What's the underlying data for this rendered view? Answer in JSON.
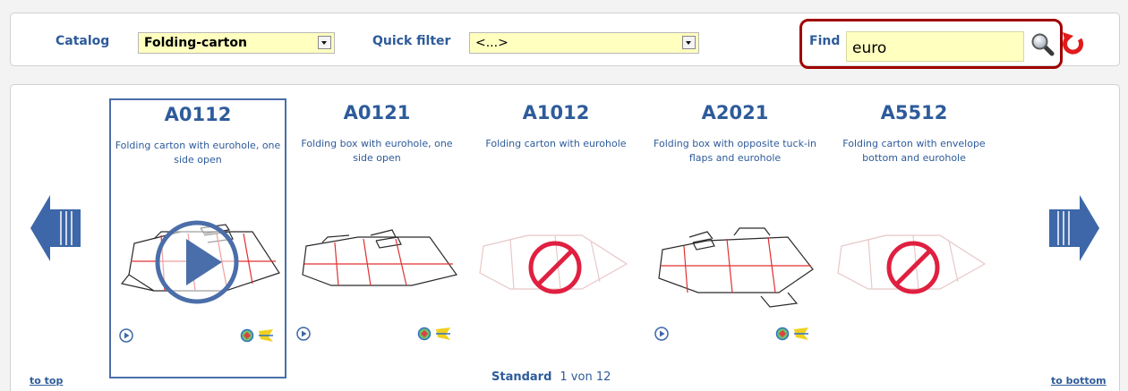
{
  "toolbar": {
    "catalog_label": "Catalog",
    "catalog_value": "Folding-carton",
    "quick_filter_label": "Quick filter",
    "quick_filter_value": "<...>",
    "find_label": "Find",
    "find_value": "euro"
  },
  "items": [
    {
      "code": "A0112",
      "description": "Folding carton with eurohole, one side open",
      "has_image": true,
      "selected": true
    },
    {
      "code": "A0121",
      "description": "Folding box with eurohole, one side open",
      "has_image": true,
      "selected": false
    },
    {
      "code": "A1012",
      "description": "Folding carton with eurohole",
      "has_image": false,
      "selected": false
    },
    {
      "code": "A2021",
      "description": "Folding box with opposite tuck-in flaps and eurohole",
      "has_image": true,
      "selected": false
    },
    {
      "code": "A5512",
      "description": "Folding carton with envelope bottom and eurohole",
      "has_image": false,
      "selected": false
    }
  ],
  "footer": {
    "to_top": "to top",
    "to_bottom": "to bottom",
    "group_label": "Standard",
    "page_info": "1 von 12"
  },
  "colors": {
    "accent": "#2e5b9a",
    "input_background": "#ffffc0",
    "highlight_border": "#a00000",
    "cut_line": "#e03030"
  },
  "icons": {
    "search": "magnifier-icon",
    "reset": "reset-arrow-icon",
    "prev": "arrow-left-icon",
    "next": "arrow-right-icon",
    "unavailable": "no-image-icon",
    "play": "play-icon"
  }
}
